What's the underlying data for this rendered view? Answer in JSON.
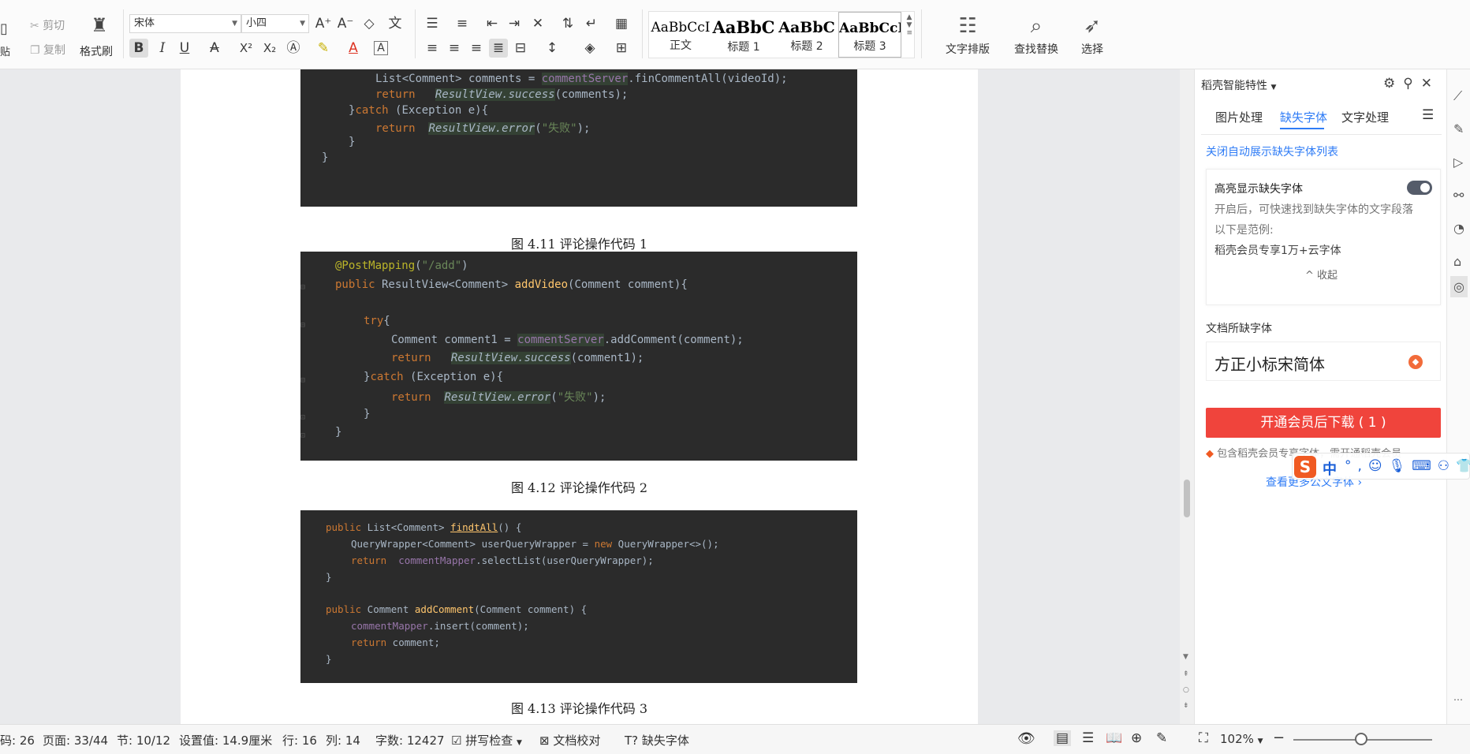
{
  "ribbon": {
    "paste": "贴",
    "cut": "剪切",
    "copy": "复制",
    "format_painter": "格式刷",
    "font_name": "宋体",
    "font_size": "小四",
    "styles": [
      {
        "sample": "AaBbCcI",
        "name": "正文"
      },
      {
        "sample": "AaBbC",
        "name": "标题 1"
      },
      {
        "sample": "AaBbC",
        "name": "标题 2"
      },
      {
        "sample": "AaBbCcI",
        "name": "标题 3"
      }
    ],
    "text_layout": "文字排版",
    "find_replace": "查找替换",
    "select": "选择"
  },
  "document": {
    "captions": [
      "图 4.11 评论操作代码 1",
      "图 4.12 评论操作代码 2",
      "图 4.13 评论操作代码 3"
    ],
    "code1": {
      "l1_prefix": "List<Comment> comments = ",
      "l1_field": "commentServer",
      "l1_suffix": ".finCommentAll(videoId);",
      "return_kw": "return",
      "success_call": "ResultView.success",
      "l2_args": "(comments);",
      "catch_open": "}",
      "catch_kw": "catch",
      "catch_rest": " (Exception e){",
      "error_call": "ResultView.error",
      "error_args_open": "(",
      "error_str": "\"失败\"",
      "error_args_close": ");",
      "close1": "}",
      "close2": "}"
    },
    "code2": {
      "annotation": "@PostMapping",
      "annotation_arg": "\"/add\"",
      "public_kw": "public",
      "sig_type": " ResultView<Comment> ",
      "method": "addVideo",
      "sig_rest": "(Comment comment){",
      "try_kw": "try",
      "try_brace": "{",
      "decl": "Comment comment1 = ",
      "field": "commentServer",
      "call": ".addComment(comment);",
      "return_kw": "return",
      "success_call": "ResultView.success",
      "success_args": "(comment1);",
      "catch_brace": "}",
      "catch_kw": "catch",
      "catch_rest": " (Exception e){",
      "error_call": "ResultView.error",
      "error_open": "(",
      "error_str": "\"失败\"",
      "error_close": ");",
      "close1": "}",
      "close2": "}"
    },
    "code3": {
      "public_kw": "public",
      "sig1_type": " List<Comment> ",
      "m1": "findtAll",
      "sig1_rest": "() {",
      "qw_type": "QueryWrapper<Comment> userQueryWrapper = ",
      "new_kw": "new",
      "qw_rest": " QueryWrapper<>();",
      "return_kw": "return",
      "mapper": "commentMapper",
      "select_call": ".selectList(userQueryWrapper);",
      "close": "}",
      "sig2_type": " Comment ",
      "m2": "addComment",
      "sig2_rest": "(Comment comment) {",
      "insert_call": ".insert(comment);",
      "ret_val": " comment;"
    }
  },
  "panel": {
    "title": "稻壳智能特性",
    "tabs": [
      "图片处理",
      "缺失字体",
      "文字处理"
    ],
    "link": "关闭自动展示缺失字体列表",
    "card_title": "高亮显示缺失字体",
    "card_desc": "开启后，可快速找到缺失字体的文字段落",
    "card_example_label": "以下是范例:",
    "card_example": "稻壳会员专享1万+云字体",
    "collapse": "收起",
    "missing_label": "文档所缺字体",
    "missing_font": "方正小标宋简体",
    "download_btn": "开通会员后下载 ( 1 )",
    "note": "包含稻壳会员专享字体，需开通稻壳会员",
    "more_link": "查看更多公文字体"
  },
  "ime": {
    "logo": "S",
    "mode": "中"
  },
  "status": {
    "words_partial": "码: 26",
    "page": "页面: 33/44",
    "section": "节: 10/12",
    "setting": "设置值: 14.9厘米",
    "row": "行: 16",
    "col": "列: 14",
    "char_count": "字数: 12427",
    "spell_check": "拼写检查",
    "doc_proof": "文档校对",
    "missing_font": "缺失字体",
    "zoom": "102%"
  }
}
